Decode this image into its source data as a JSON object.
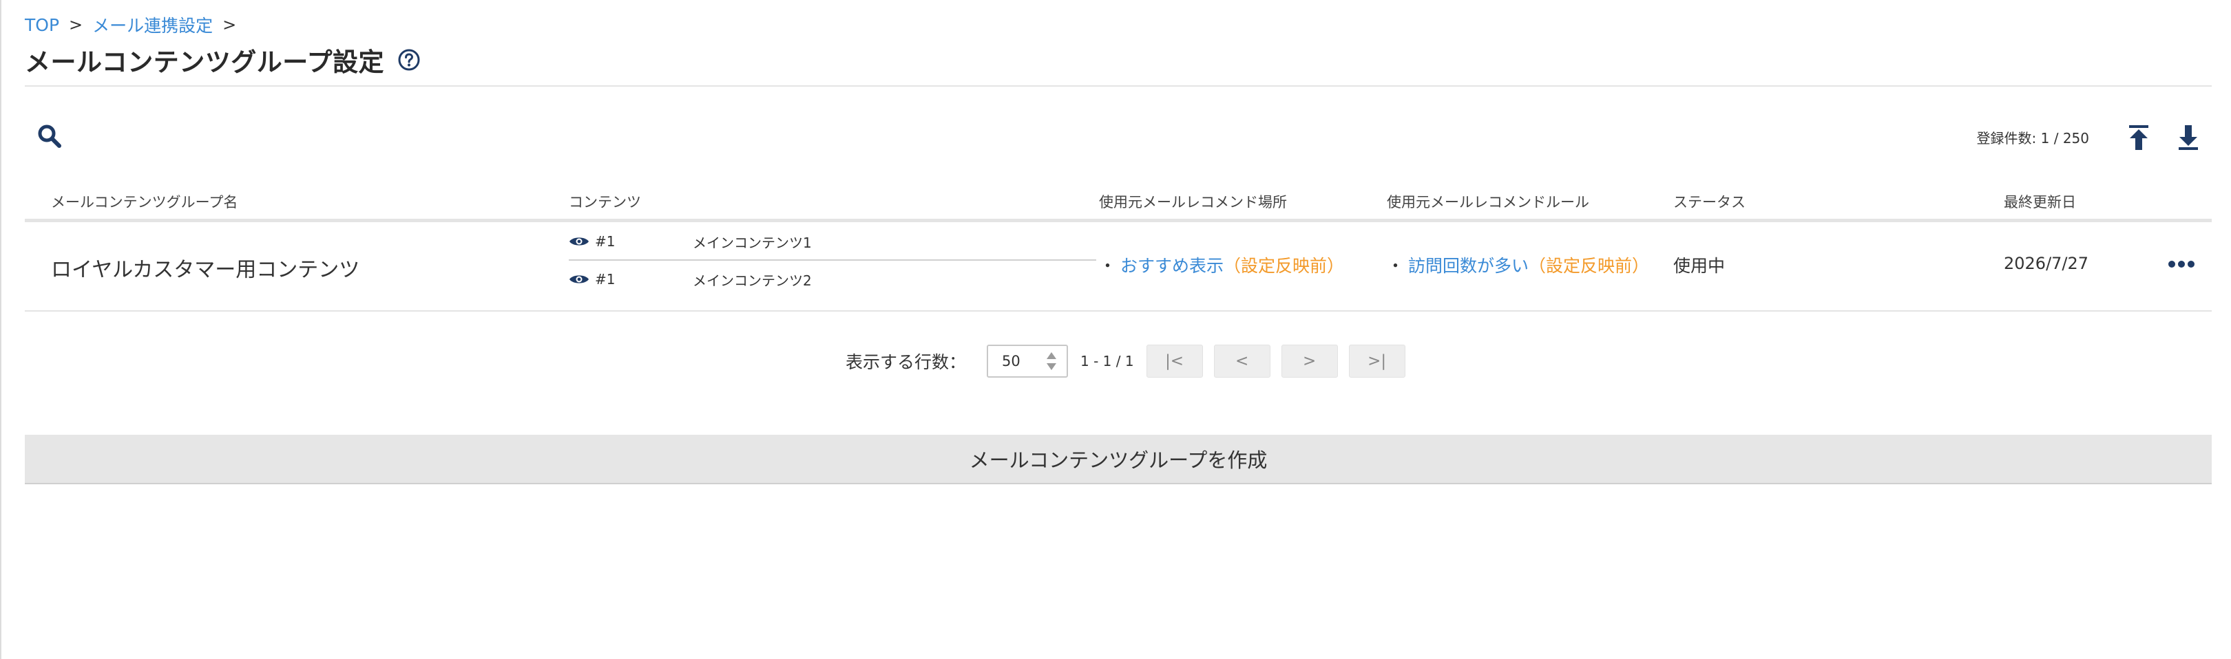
{
  "breadcrumb": {
    "items": [
      "TOP",
      "メール連携設定"
    ],
    "separator": ">"
  },
  "header": {
    "title": "メールコンテンツグループ設定",
    "help_icon": "question-circle-icon"
  },
  "toolbar": {
    "search_icon": "search-icon",
    "count_label": "登録件数: 1 / 250",
    "upload_icon": "upload-icon",
    "download_icon": "download-icon"
  },
  "table": {
    "columns": [
      "メールコンテンツグループ名",
      "コンテンツ",
      "使用元メールレコメンド場所",
      "使用元メールレコメンドルール",
      "ステータス",
      "最終更新日"
    ],
    "rows": [
      {
        "name": "ロイヤルカスタマー用コンテンツ",
        "contents": [
          {
            "num": "#1",
            "name": "メインコンテンツ1"
          },
          {
            "num": "#1",
            "name": "メインコンテンツ2"
          }
        ],
        "recommend_place": {
          "bullet": "・",
          "link": "おすすめ表示",
          "note": "（設定反映前）"
        },
        "recommend_rule": {
          "bullet": "・",
          "link": "訪問回数が多い",
          "note": "（設定反映前）"
        },
        "status": "使用中",
        "updated": "2026/7/27",
        "more_icon": "more-horizontal-icon"
      }
    ]
  },
  "pagination": {
    "label": "表示する行数：",
    "rows_per_page": "50",
    "range": "1 - 1 / 1",
    "first": "|<",
    "prev": "<",
    "next": ">",
    "last": ">|"
  },
  "actions": {
    "create_label": "メールコンテンツグループを作成"
  },
  "colors": {
    "accent": "#3a8ad6",
    "icon_dark": "#1f3b66",
    "pending": "#f39a2a"
  }
}
